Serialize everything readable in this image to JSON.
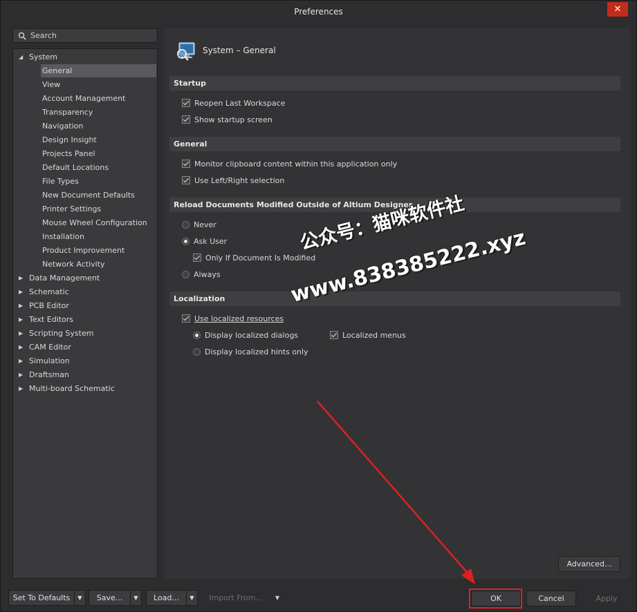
{
  "window": {
    "title": "Preferences",
    "close_glyph": "✕"
  },
  "search": {
    "placeholder": "Search",
    "icon": "search-icon"
  },
  "tree": {
    "system_label": "System",
    "system_children": [
      "General",
      "View",
      "Account Management",
      "Transparency",
      "Navigation",
      "Design Insight",
      "Projects Panel",
      "Default Locations",
      "File Types",
      "New Document Defaults",
      "Printer Settings",
      "Mouse Wheel Configuration",
      "Installation",
      "Product Improvement",
      "Network Activity"
    ],
    "selected": "General",
    "top_items": [
      "Data Management",
      "Schematic",
      "PCB Editor",
      "Text Editors",
      "Scripting System",
      "CAM Editor",
      "Simulation",
      "Draftsman",
      "Multi-board Schematic"
    ]
  },
  "content": {
    "header_title": "System – General",
    "header_icon": "system-general-icon",
    "sections": {
      "startup": {
        "title": "Startup",
        "options": [
          {
            "label": "Reopen Last Workspace",
            "checked": true
          },
          {
            "label": "Show startup screen",
            "checked": true
          }
        ]
      },
      "general": {
        "title": "General",
        "options": [
          {
            "label": "Monitor clipboard content within this application only",
            "checked": true
          },
          {
            "label": "Use Left/Right selection",
            "checked": true
          }
        ]
      },
      "reload": {
        "title": "Reload Documents Modified Outside of Altium Designer",
        "never": "Never",
        "ask_user": "Ask User",
        "only_if_modified": "Only If Document Is Modified",
        "always": "Always",
        "selected": "Ask User"
      },
      "localization": {
        "title": "Localization",
        "use_localized": "Use localized resources",
        "display_dialogs": "Display localized dialogs",
        "display_hints": "Display localized hints only",
        "localized_menus": "Localized menus"
      }
    }
  },
  "footer": {
    "set_defaults": "Set To Defaults",
    "save": "Save...",
    "load": "Load...",
    "import_from": "Import From...",
    "advanced": "Advanced...",
    "ok": "OK",
    "cancel": "Cancel",
    "apply": "Apply"
  },
  "watermark": {
    "line1": "公众号：猫咪软件社",
    "line2": "www.838385222.xyz"
  },
  "colors": {
    "highlight": "#e02020",
    "close": "#c42b1c",
    "selected": "#5a5a5e"
  }
}
